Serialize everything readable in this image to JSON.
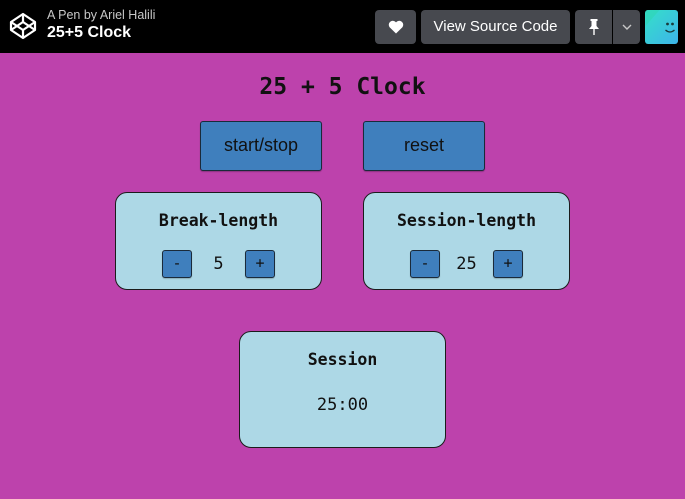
{
  "header": {
    "pen_by": "A Pen by Ariel Halili",
    "pen_title": "25+5 Clock",
    "view_source_label": "View Source Code",
    "logo_icon": "codepen-logo-icon",
    "heart_icon": "heart-icon",
    "pin_icon": "pin-icon",
    "caret_icon": "chevron-down-icon",
    "avatar_icon": "user-avatar-icon"
  },
  "clock": {
    "title": "25 + 5 Clock",
    "start_stop_label": "start/stop",
    "reset_label": "reset",
    "break": {
      "label": "Break-length",
      "decrement": "-",
      "increment": "+",
      "value": "5"
    },
    "session": {
      "label": "Session-length",
      "decrement": "-",
      "increment": "+",
      "value": "25"
    },
    "timer": {
      "label": "Session",
      "time": "25:00"
    }
  },
  "colors": {
    "background": "#bd42ac",
    "panel": "#add8e6",
    "button": "#3f7fbd",
    "topbar": "#000000"
  }
}
